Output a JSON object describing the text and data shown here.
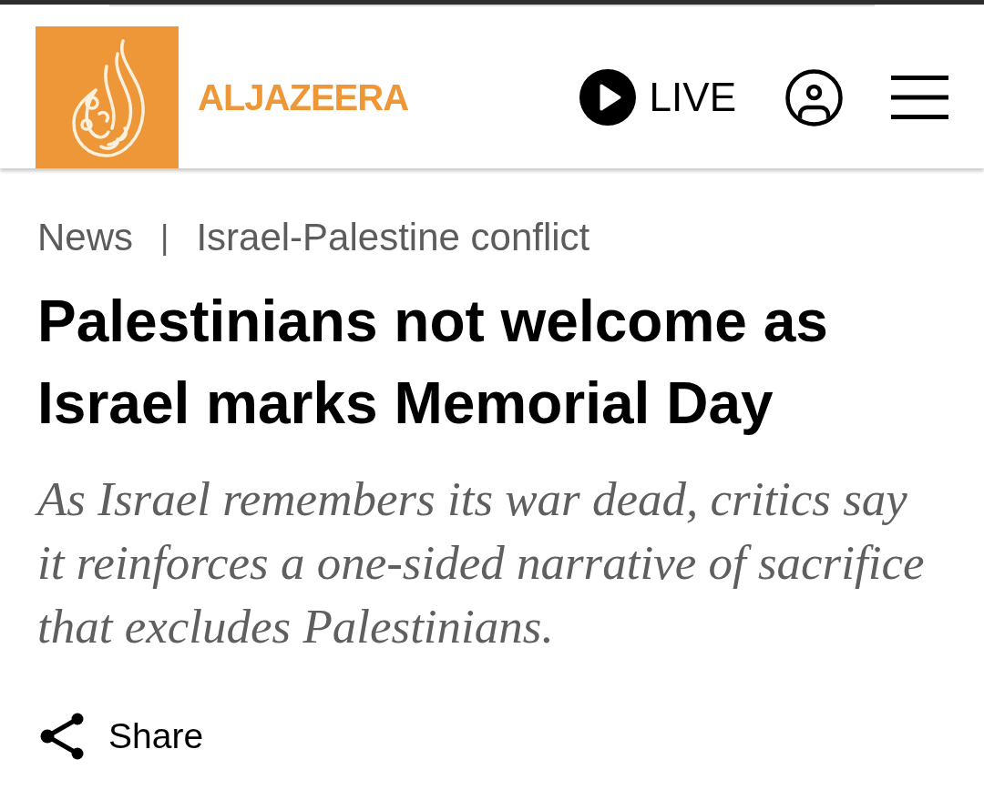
{
  "header": {
    "wordmark": "ALJAZEERA",
    "live_label": "LIVE"
  },
  "breadcrumb": {
    "items": [
      {
        "label": "News"
      },
      {
        "label": "Israel-Palestine conflict"
      }
    ],
    "separator": "|"
  },
  "headline": "Palestinians not welcome as Israel marks Memorial Day",
  "standfirst": "As Israel remembers its war dead, critics say it reinforces a one-sided narrative of sacrifice that excludes Palestinians.",
  "share": {
    "label": "Share"
  }
}
